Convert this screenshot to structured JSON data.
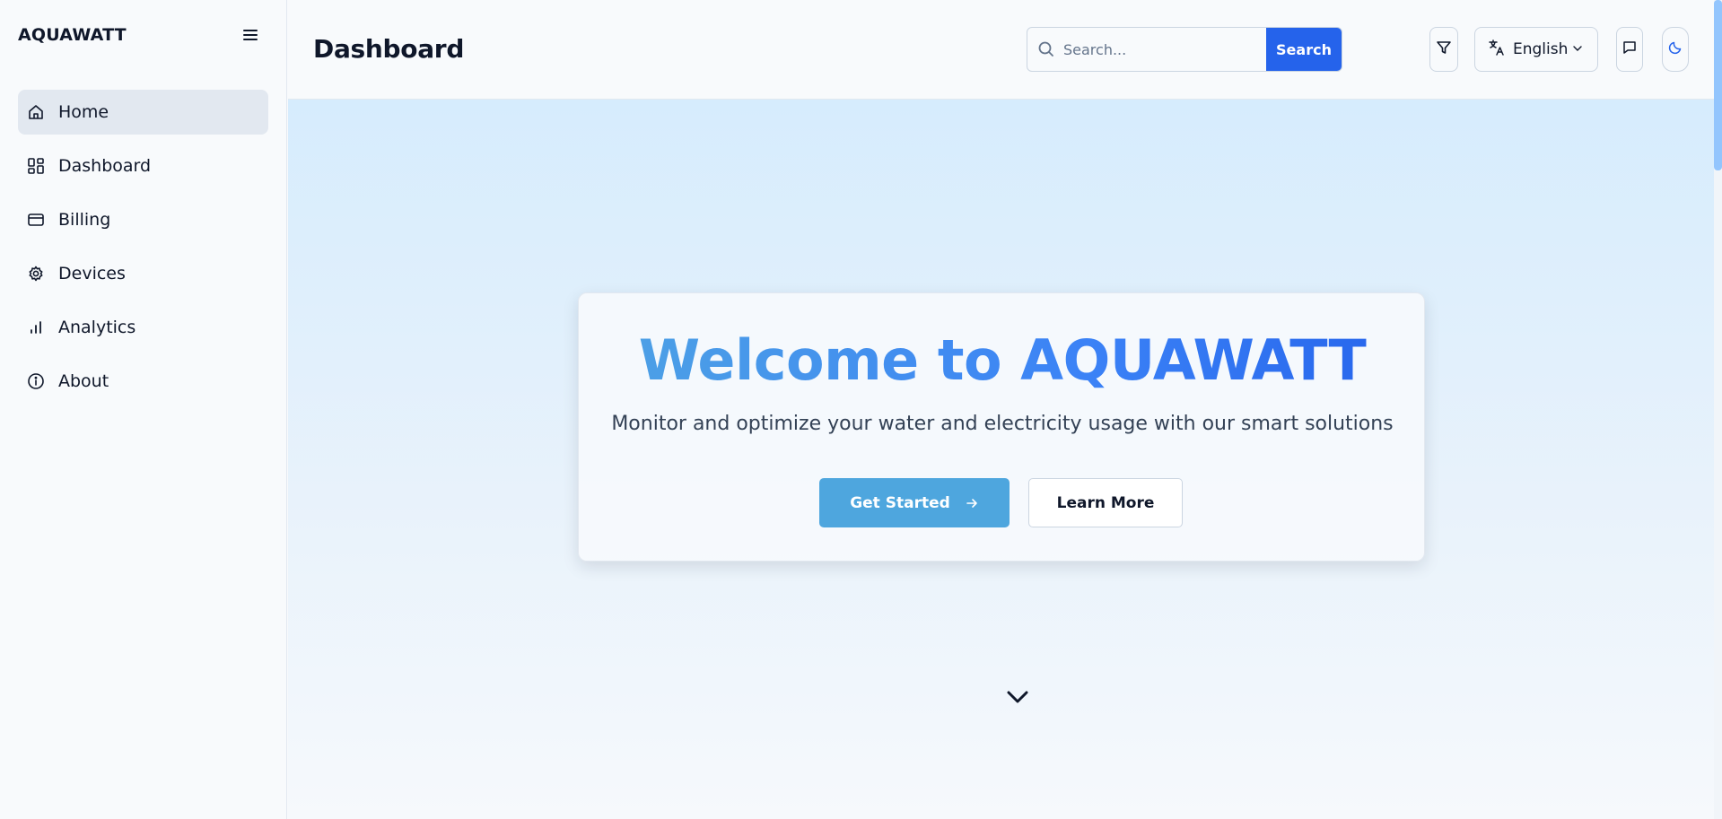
{
  "brand": {
    "name": "AQUAWATT"
  },
  "sidebar": {
    "items": [
      {
        "label": "Home",
        "icon": "home-icon",
        "active": true
      },
      {
        "label": "Dashboard",
        "icon": "dashboard-icon",
        "active": false
      },
      {
        "label": "Billing",
        "icon": "credit-card-icon",
        "active": false
      },
      {
        "label": "Devices",
        "icon": "gear-icon",
        "active": false
      },
      {
        "label": "Analytics",
        "icon": "bar-chart-icon",
        "active": false
      },
      {
        "label": "About",
        "icon": "info-icon",
        "active": false
      }
    ]
  },
  "header": {
    "title": "Dashboard",
    "search": {
      "placeholder": "Search...",
      "value": "",
      "button_label": "Search"
    },
    "language": {
      "selected": "English"
    }
  },
  "hero": {
    "title": "Welcome to AQUAWATT",
    "subtitle": "Monitor and optimize your water and electricity usage with our smart solutions",
    "primary_button": "Get Started",
    "secondary_button": "Learn More"
  },
  "colors": {
    "accent": "#2563eb",
    "primary_button": "#4ea6de",
    "active_nav": "#e2e8f0"
  }
}
